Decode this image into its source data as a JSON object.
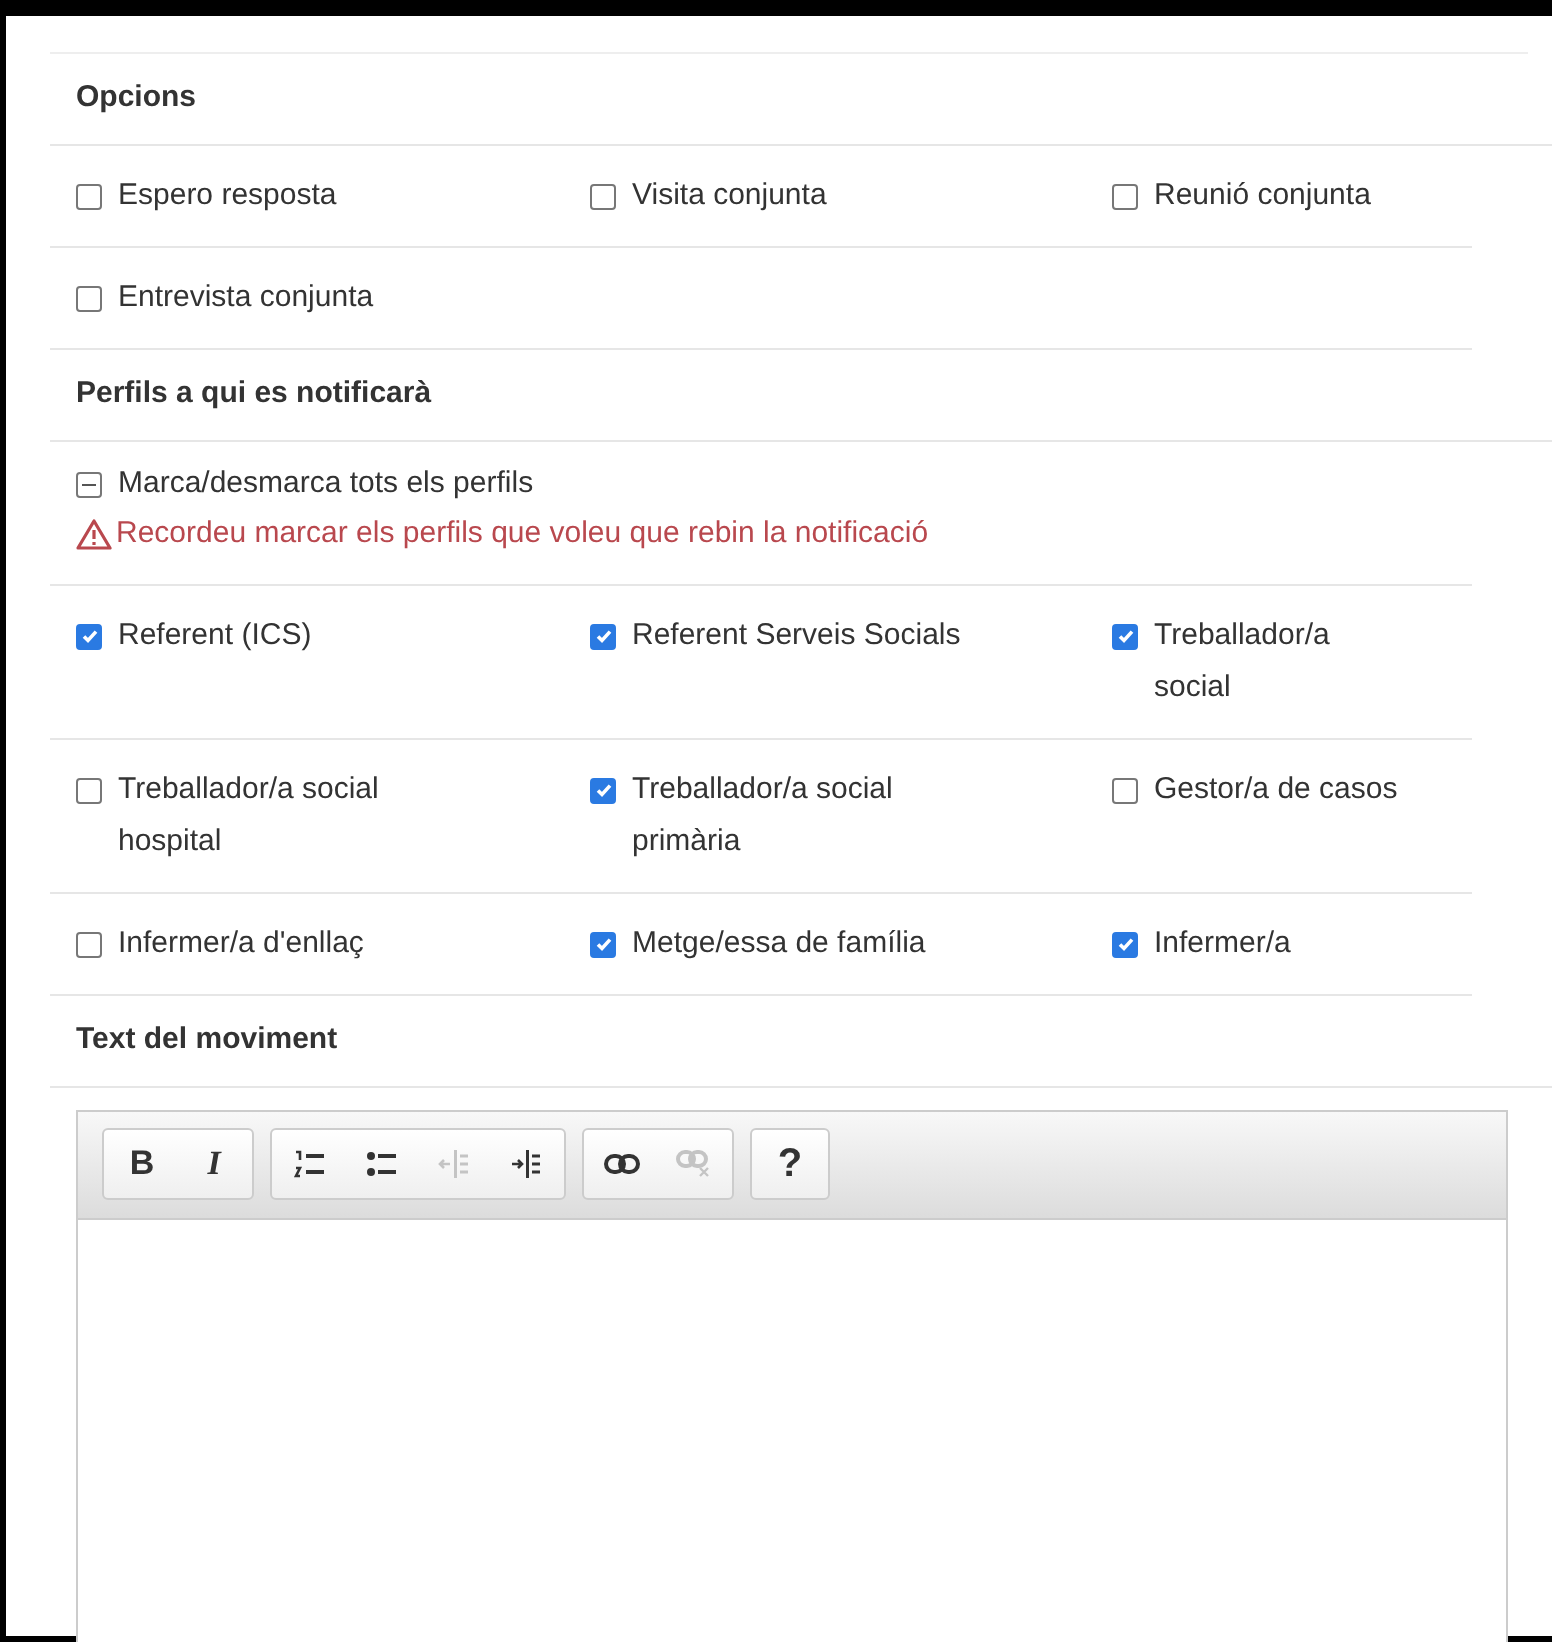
{
  "options": {
    "title": "Opcions",
    "items": [
      {
        "label": "Espero resposta",
        "checked": false
      },
      {
        "label": "Visita conjunta",
        "checked": false
      },
      {
        "label": "Reunió conjunta",
        "checked": false
      },
      {
        "label": "Entrevista conjunta",
        "checked": false
      }
    ]
  },
  "profiles": {
    "title": "Perfils a qui es notificarà",
    "toggle_all": {
      "label": "Marca/desmarca tots els perfils",
      "indeterminate": true
    },
    "warning": "Recordeu marcar els perfils que voleu que rebin la notificació",
    "items": [
      {
        "label": "Referent (ICS)",
        "checked": true
      },
      {
        "label": "Referent Serveis Socials",
        "checked": true
      },
      {
        "label": "Treballador/a social",
        "checked": true
      },
      {
        "label": "Treballador/a social hospital",
        "checked": false
      },
      {
        "label": "Treballador/a social primària",
        "checked": true
      },
      {
        "label": "Gestor/a de casos",
        "checked": false
      },
      {
        "label": "Infermer/a d'enllaç",
        "checked": false
      },
      {
        "label": "Metge/essa de família",
        "checked": true
      },
      {
        "label": "Infermer/a",
        "checked": true
      }
    ]
  },
  "editor": {
    "title": "Text del moviment",
    "toolbar": [
      [
        {
          "kind": "bold",
          "label": "B",
          "disabled": false
        },
        {
          "kind": "italic",
          "label": "I",
          "disabled": false
        }
      ],
      [
        {
          "kind": "ordered-list",
          "disabled": false
        },
        {
          "kind": "bullet-list",
          "disabled": false
        },
        {
          "kind": "outdent",
          "disabled": true
        },
        {
          "kind": "indent",
          "disabled": false
        }
      ],
      [
        {
          "kind": "link",
          "disabled": false
        },
        {
          "kind": "unlink",
          "disabled": true
        }
      ],
      [
        {
          "kind": "help",
          "label": "?",
          "disabled": false
        }
      ]
    ]
  }
}
